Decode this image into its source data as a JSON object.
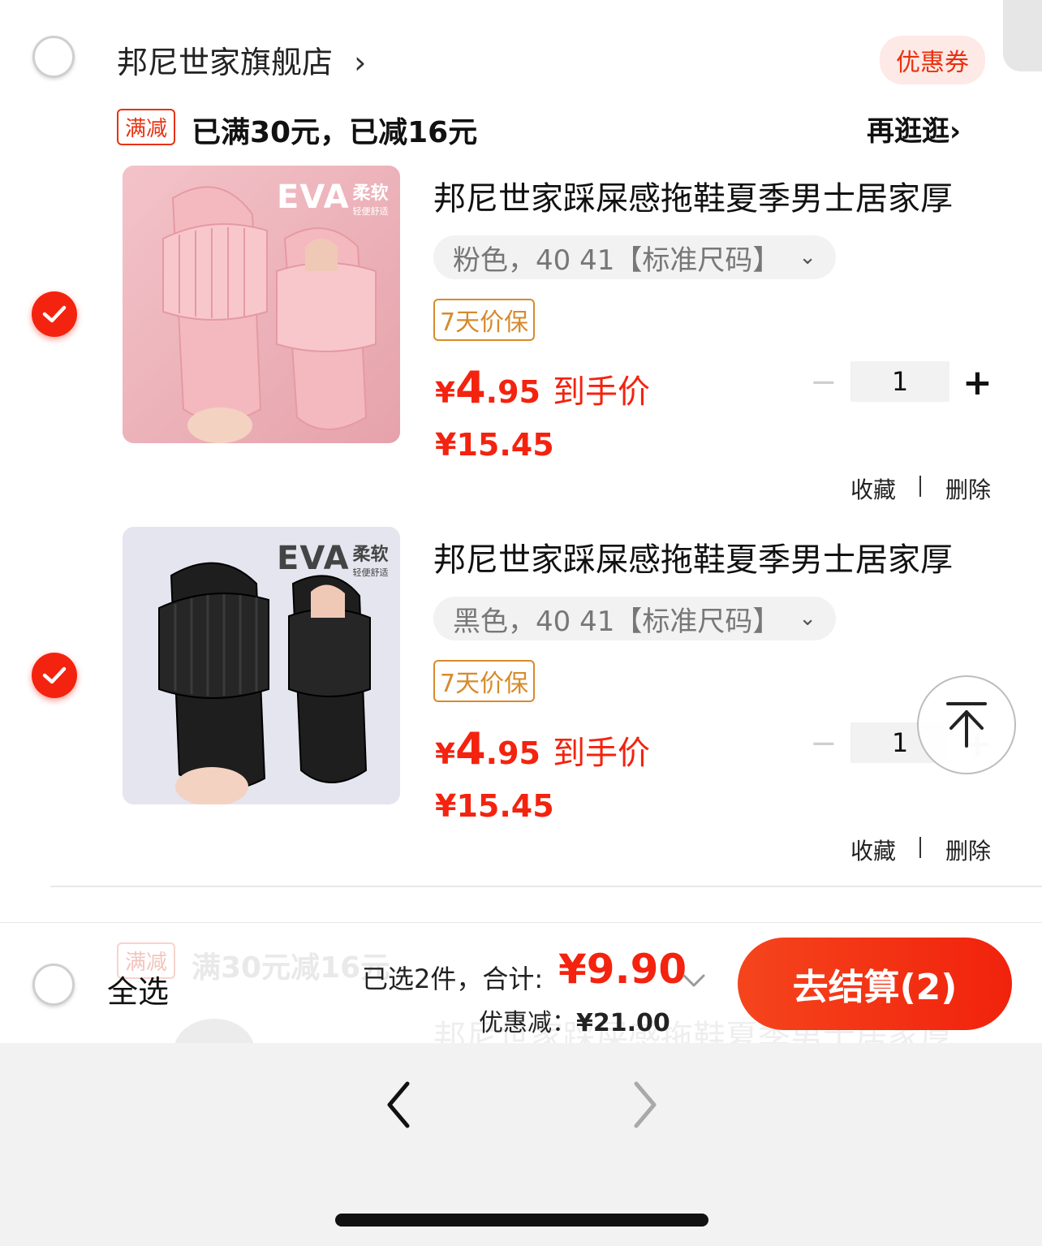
{
  "store": {
    "name": "邦尼世家旗舰店",
    "chevron": "›",
    "coupon_label": "优惠券"
  },
  "promo": {
    "tag": "满减",
    "text": "已满30元，已减16元",
    "browse_label": "再逛逛",
    "browse_chevron": "›"
  },
  "products": [
    {
      "image_badge": "EVA",
      "image_badge_cn": "柔软",
      "image_badge_sub": "轻便舒适",
      "title": "邦尼世家踩屎感拖鞋夏季男士居家厚",
      "sku": "粉色，40 41【标准尺码】",
      "sku_chevron": "⌄",
      "guarantee": "7天价保",
      "price_symbol": "¥",
      "price_int": "4",
      "price_dec": ".95",
      "price_suffix": "到手价",
      "original_price": "¥15.45",
      "quantity": "1",
      "minus": "−",
      "plus": "+",
      "favorite": "收藏",
      "delete": "删除",
      "color": "#f2b1b7"
    },
    {
      "image_badge": "EVA",
      "image_badge_cn": "柔软",
      "image_badge_sub": "轻便舒适",
      "title": "邦尼世家踩屎感拖鞋夏季男士居家厚",
      "sku": "黑色，40 41【标准尺码】",
      "sku_chevron": "⌄",
      "guarantee": "7天价保",
      "price_symbol": "¥",
      "price_int": "4",
      "price_dec": ".95",
      "price_suffix": "到手价",
      "original_price": "¥15.45",
      "quantity": "1",
      "minus": "−",
      "plus": "+",
      "favorite": "收藏",
      "delete": "删除",
      "color": "#1b1b1b"
    }
  ],
  "behind_bar": {
    "promo_tag": "满减",
    "promo_text": "满30元减16元",
    "product_title": "邦尼世家踩屎感拖鞋夏季男士居家厚"
  },
  "footer": {
    "select_all": "全选",
    "selected_count_label": "已选2件，合计:",
    "total": "¥9.90",
    "discount_label": "优惠减：",
    "discount_value": "¥21.00",
    "checkout_label": "去结算(2)"
  },
  "browser_nav": {
    "back": "‹",
    "forward": "›"
  }
}
